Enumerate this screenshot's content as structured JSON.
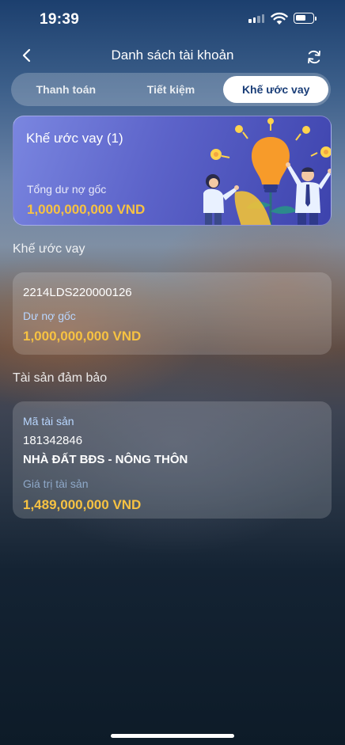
{
  "status_bar": {
    "time": "19:39"
  },
  "header": {
    "title": "Danh sách tài khoản"
  },
  "tabs": [
    {
      "label": "Thanh toán",
      "active": false
    },
    {
      "label": "Tiết kiệm",
      "active": false
    },
    {
      "label": "Khế ước vay",
      "active": true
    }
  ],
  "summary_card": {
    "title": "Khế ước vay (1)",
    "label": "Tổng dư nợ gốc",
    "amount": "1,000,000,000 VND"
  },
  "loans_section": {
    "title": "Khế ước vay",
    "items": [
      {
        "contract_no": "2214LDS220000126",
        "principal_label": "Dư nợ gốc",
        "principal_amount": "1,000,000,000 VND"
      }
    ]
  },
  "collateral_section": {
    "title": "Tài sản đảm bảo",
    "items": [
      {
        "asset_code_label": "Mã tài sản",
        "asset_code": "181342846",
        "asset_name": "NHÀ ĐẤT BĐS - NÔNG THÔN",
        "value_label": "Giá trị tài sản",
        "value_amount": "1,489,000,000 VND"
      }
    ]
  },
  "colors": {
    "accent_gold": "#f7c242",
    "tab_active_text": "#1a3e78",
    "hero_gradient_start": "#7a86e0",
    "hero_gradient_end": "#3d43ad"
  },
  "icons": [
    "back-chevron-icon",
    "refresh-icon",
    "signal-icon",
    "wifi-icon",
    "battery-icon",
    "lightbulb-illustration"
  ]
}
